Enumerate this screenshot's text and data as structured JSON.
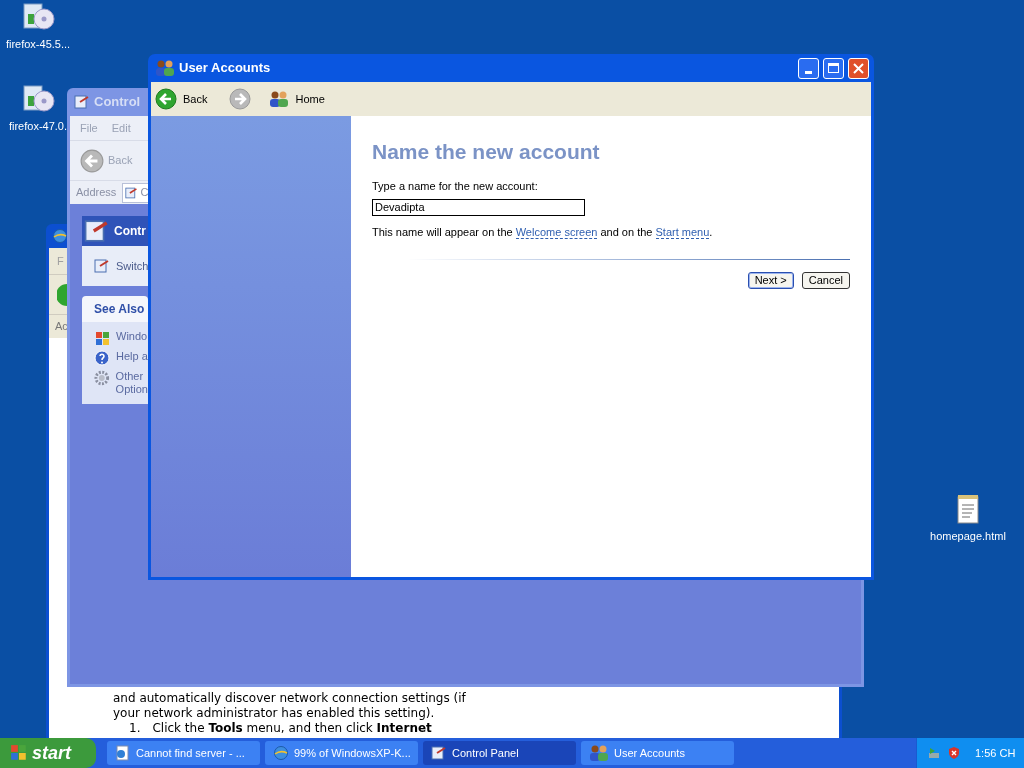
{
  "desktop_icons": [
    {
      "kind": "installer",
      "label": "firefox-45.5..."
    },
    {
      "kind": "installer",
      "label": "firefox-47.0."
    },
    {
      "kind": "document",
      "label": "homepage.html"
    }
  ],
  "ie_window": {
    "menu_initial": "F",
    "address_initial": "Ac",
    "body_lines": [
      "and automatically discover network connection settings (if",
      "your network administrator has enabled this setting)."
    ],
    "step": {
      "number": "1.",
      "text": "Click the **Tools** menu, and then click **Internet**"
    }
  },
  "control_panel_window": {
    "title": "Control",
    "menu": [
      "File",
      "Edit"
    ],
    "back": "Back",
    "address_label": "Address",
    "address_value": "C",
    "panel_title": "Contr",
    "panel_item": "Switch",
    "see_also": {
      "title": "See Also",
      "items": [
        {
          "kind": "windows",
          "lines": [
            "Windo"
          ]
        },
        {
          "kind": "help",
          "lines": [
            "Help a"
          ]
        },
        {
          "kind": "gear",
          "lines": [
            "Other",
            "Option"
          ]
        }
      ]
    }
  },
  "user_accounts": {
    "title": "User Accounts",
    "back": "Back",
    "home": "Home",
    "heading": "Name the new account",
    "prompt": "Type a name for the new account:",
    "name_value": "Devadipta",
    "note": [
      {
        "kind": "text",
        "text": "This name will appear on the"
      },
      {
        "kind": "link",
        "text": "Welcome screen"
      },
      {
        "kind": "text",
        "text": "and on the"
      },
      {
        "kind": "link",
        "text": "Start menu"
      },
      {
        "kind": "text",
        "text": "."
      }
    ],
    "buttons": [
      {
        "label": "Next >",
        "default": true
      },
      {
        "label": "Cancel",
        "default": false
      }
    ]
  },
  "taskbar": {
    "start": "start",
    "tasks": [
      {
        "kind": "page",
        "label": "Cannot find server - ...",
        "selected": false
      },
      {
        "kind": "browser",
        "label": "99% of WindowsXP-K...",
        "selected": false
      },
      {
        "kind": "control",
        "label": "Control Panel",
        "selected": true
      },
      {
        "kind": "users",
        "label": "User Accounts",
        "selected": false
      }
    ],
    "clock": "1:56 CH"
  }
}
